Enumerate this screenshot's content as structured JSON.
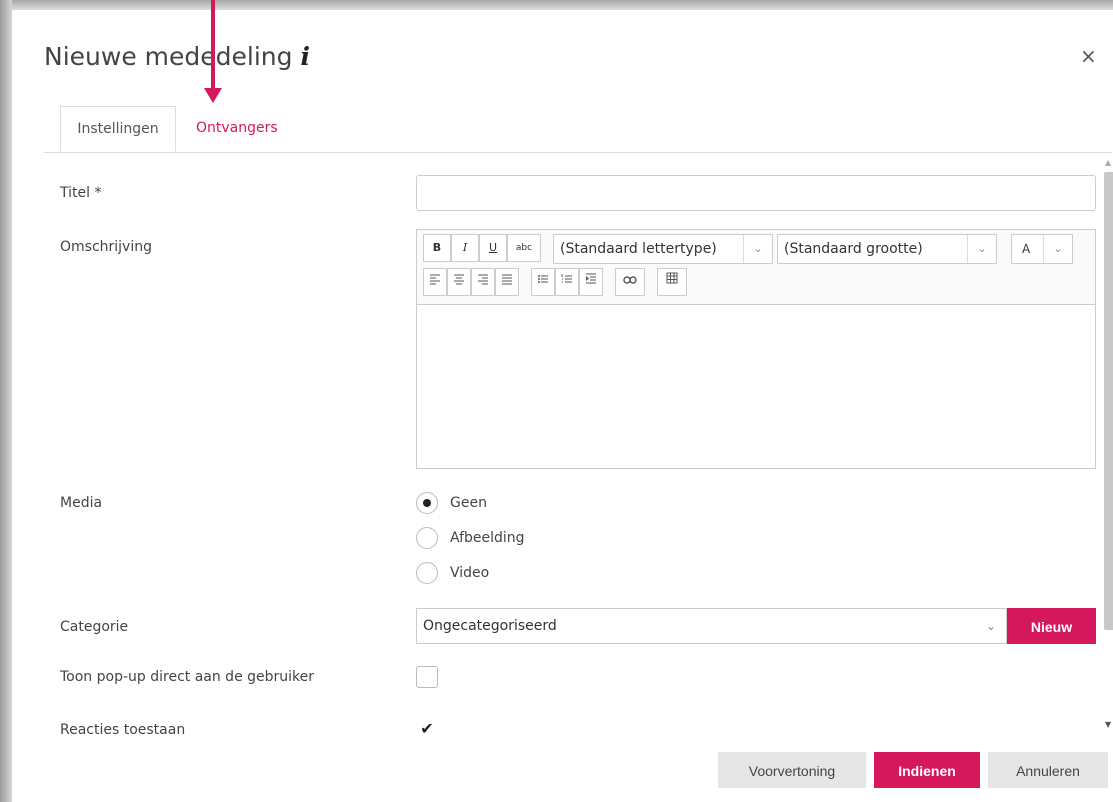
{
  "dialog": {
    "title": "Nieuwe mededeling",
    "info_glyph": "i",
    "close_glyph": "×"
  },
  "tabs": [
    {
      "label": "Instellingen",
      "active": true
    },
    {
      "label": "Ontvangers",
      "active": false
    }
  ],
  "form": {
    "titel_label": "Titel *",
    "titel_value": "",
    "omschrijving_label": "Omschrijving",
    "editor": {
      "bold": "B",
      "italic": "I",
      "underline": "U",
      "strike": "abc",
      "font_select": "(Standaard lettertype)",
      "size_select": "(Standaard grootte)",
      "font_color": "A",
      "dropdown_glyph": "⌄"
    },
    "media_label": "Media",
    "media_options": [
      "Geen",
      "Afbeelding",
      "Video"
    ],
    "media_selected": "Geen",
    "categorie_label": "Categorie",
    "categorie_value": "Ongecategoriseerd",
    "nieuw_label": "Nieuw",
    "popup_label": "Toon pop-up direct aan de gebruiker",
    "popup_checked": false,
    "reacties_label": "Reacties toestaan",
    "reacties_checked": true,
    "check_glyph": "✔"
  },
  "footer": {
    "preview_label": "Voorvertoning",
    "submit_label": "Indienen",
    "cancel_label": "Annuleren"
  },
  "colors": {
    "accent": "#d5175e"
  },
  "icons": [
    "info-icon",
    "close-icon",
    "align-left-icon",
    "align-center-icon",
    "align-right-icon",
    "justify-icon",
    "bullet-list-icon",
    "numbered-list-icon",
    "indent-icon",
    "link-icon",
    "table-icon",
    "chevron-down-icon",
    "checkmark-icon",
    "arrow-pointer"
  ]
}
